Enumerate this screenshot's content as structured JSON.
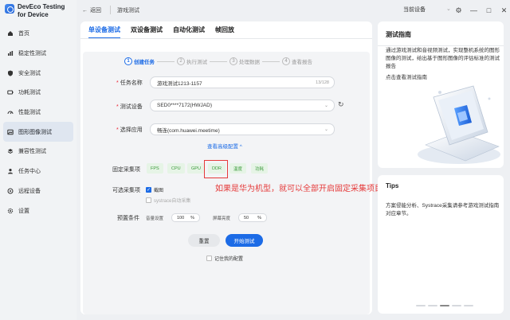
{
  "app": {
    "title_line1": "DevEco Testing",
    "title_line2": "for Device"
  },
  "sidebar": {
    "items": [
      {
        "label": "首页",
        "icon": "home-icon"
      },
      {
        "label": "稳定性测试",
        "icon": "chart-icon"
      },
      {
        "label": "安全测试",
        "icon": "shield-icon"
      },
      {
        "label": "功耗测试",
        "icon": "battery-icon"
      },
      {
        "label": "性能测试",
        "icon": "gauge-icon"
      },
      {
        "label": "图形图像测试",
        "icon": "image-icon",
        "active": true
      },
      {
        "label": "兼容性测试",
        "icon": "layers-icon"
      },
      {
        "label": "任务中心",
        "icon": "user-icon"
      },
      {
        "label": "远程设备",
        "icon": "device-icon"
      },
      {
        "label": "设置",
        "icon": "gear-icon"
      }
    ]
  },
  "topbar": {
    "back_label": "返回",
    "breadcrumb": "游戏测试",
    "device_label": "当前设备"
  },
  "tabs": [
    "单设备测试",
    "双设备测试",
    "自动化测试",
    "帧回放"
  ],
  "steps": [
    {
      "num": "1",
      "label": "创建任务"
    },
    {
      "num": "2",
      "label": "执行测试"
    },
    {
      "num": "3",
      "label": "处理数据"
    },
    {
      "num": "4",
      "label": "查看报告"
    }
  ],
  "form": {
    "task_name_label": "任务名称",
    "task_name_value": "游戏测试1213-1157",
    "task_name_counter": "13/128",
    "device_label": "测试设备",
    "device_value": "SED0****7172(HWJAD)",
    "app_label": "选择应用",
    "app_value": "畅连(com.huawei.meetime)",
    "advanced_toggle": "查看高级配置 ^",
    "fixed_collect_label": "固定采集项",
    "fixed_items": [
      "FPS",
      "CPU",
      "GPU",
      "DDR",
      "温度",
      "功耗"
    ],
    "optional_collect_label": "可选采集项",
    "opt_screenshot": "截图",
    "opt_systrace": "systrace自动采集",
    "preset_label": "预置条件",
    "volume_label": "音量设置",
    "volume_value": "100",
    "brightness_label": "屏幕亮度",
    "brightness_value": "50",
    "percent": "%",
    "reset_button": "重置",
    "start_button": "开始测试",
    "remember_label": "记住我的配置"
  },
  "annotation": "如果是华为机型，就可以全部开启固定采集项目",
  "guide": {
    "title": "测试指南",
    "desc": "通过游戏测试和音视频测试，实现整机系统的图形图像的测试，给出基于图形图像的评估标准的测试报告",
    "link": "点击查看测试指南"
  },
  "tips": {
    "title": "Tips",
    "desc": "方案侵能分析、Systrace采集请参考游戏测试指南对应章节。"
  },
  "colors": {
    "accent": "#1c6be6",
    "annotation": "#e53a3a",
    "chip_bg": "#e6f4e6",
    "chip_text": "#3a9a3a"
  }
}
